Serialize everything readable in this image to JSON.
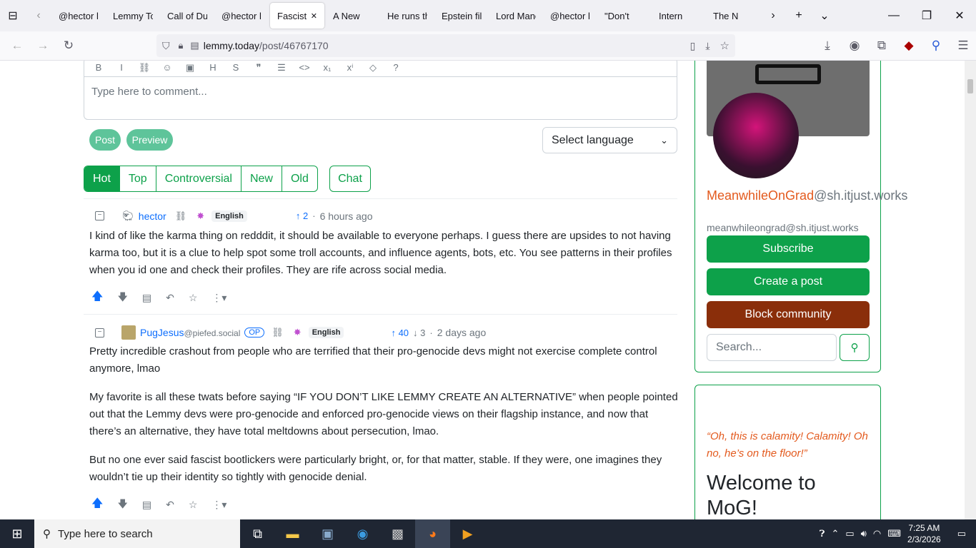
{
  "tabs": [
    {
      "label": "@hector l"
    },
    {
      "label": "Lemmy To"
    },
    {
      "label": "Call of Dut"
    },
    {
      "label": "@hector l"
    },
    {
      "label": "Fascist l",
      "active": true
    },
    {
      "label": "A New"
    },
    {
      "label": "He runs th"
    },
    {
      "label": "Epstein file"
    },
    {
      "label": "Lord Manc"
    },
    {
      "label": "@hector l"
    },
    {
      "label": "\"Don't"
    },
    {
      "label": "Intern"
    },
    {
      "label": "The N"
    }
  ],
  "url": {
    "domain": "lemmy.today",
    "path": "/post/46767170"
  },
  "editor": {
    "placeholder": "Type here to comment...",
    "tools": [
      "B",
      "I",
      "⛓",
      "☺",
      "▣",
      "H",
      "S",
      "❞",
      "☰",
      "<>",
      "x₁",
      "xⁱ",
      "◇",
      "?"
    ]
  },
  "buttons": {
    "post": "Post",
    "preview": "Preview"
  },
  "language_select": "Select language",
  "sorts": [
    "Hot",
    "Top",
    "Controversial",
    "New",
    "Old"
  ],
  "chat": "Chat",
  "comments": [
    {
      "user": "hector",
      "instance": "",
      "language": "English",
      "score": "2",
      "downvotes": "",
      "age": "6 hours ago",
      "op": "",
      "paragraphs": [
        "I kind of like the karma thing on redddit, it should be available to everyone perhaps. I guess there are upsides to not having karma too, but it is a clue to help spot some troll accounts, and influence agents, bots, etc. You see patterns in their profiles when you id one and check their profiles. They are rife across social media."
      ]
    },
    {
      "user": "PugJesus",
      "instance": "@piefed.social",
      "language": "English",
      "score": "40",
      "downvotes": "3",
      "age": "2 days ago",
      "op": "OP",
      "paragraphs": [
        "Pretty incredible crashout from people who are terrified that their pro-genocide devs might not exercise complete control anymore, lmao",
        "My favorite is all these twats before saying “IF YOU DON’T LIKE LEMMY CREATE AN ALTERNATIVE” when people pointed out that the Lemmy devs were pro-genocide and enforced pro-genocide views on their flagship instance, and now that there’s an alternative, they have total meltdowns about persecution, lmao.",
        "But no one ever said fascist bootlickers were particularly bright, or, for that matter, stable. If they were, one imagines they wouldn’t tie up their identity so tightly with genocide denial."
      ]
    }
  ],
  "community": {
    "name": "MeanwhileOnGrad",
    "instance": "@sh.itjust.works",
    "handle": "meanwhileongrad@sh.itjust.works",
    "subscribe": "Subscribe",
    "create_post": "Create a post",
    "block": "Block community",
    "search_placeholder": "Search...",
    "quote": "“Oh, this is calamity! Calamity! Oh no, he’s on the floor!”",
    "welcome": "Welcome to MoG!"
  },
  "taskbar": {
    "search": "Type here to search",
    "time": "7:25 AM",
    "date": "2/3/2026"
  },
  "colors": {
    "accent": "#0da14a",
    "block": "#8a2e0a",
    "orange": "#e35a1e",
    "link": "#0d6efd"
  }
}
